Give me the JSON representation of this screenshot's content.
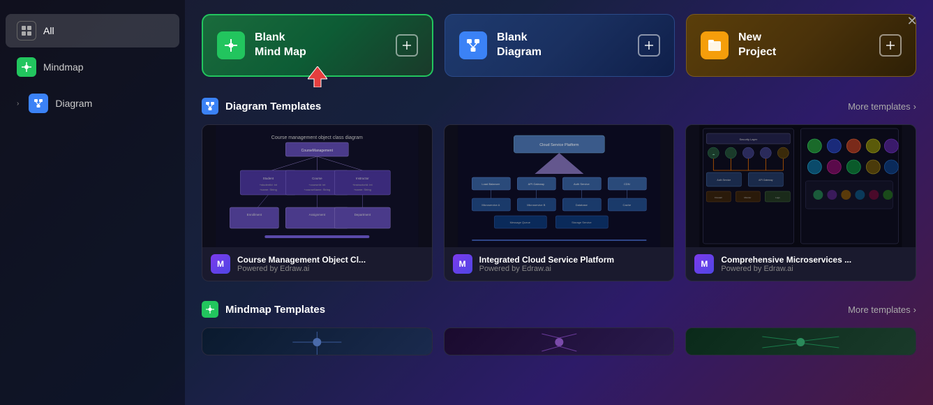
{
  "sidebar": {
    "items": [
      {
        "id": "all",
        "label": "All",
        "icon": "grid",
        "active": true
      },
      {
        "id": "mindmap",
        "label": "Mindmap",
        "icon": "mindmap"
      },
      {
        "id": "diagram",
        "label": "Diagram",
        "icon": "diagram",
        "hasChevron": true
      }
    ]
  },
  "topCards": [
    {
      "id": "blank-mindmap",
      "line1": "Blank",
      "line2": "Mind Map",
      "iconType": "mindmap",
      "addLabel": "+",
      "hasArrow": true
    },
    {
      "id": "blank-diagram",
      "line1": "Blank",
      "line2": "Diagram",
      "iconType": "diagram",
      "addLabel": "+"
    },
    {
      "id": "new-project",
      "line1": "New",
      "line2": "Project",
      "iconType": "project",
      "addLabel": "+"
    }
  ],
  "sections": [
    {
      "id": "diagram-templates",
      "title": "Diagram Templates",
      "iconType": "diagram",
      "moreLabel": "More templates",
      "templates": [
        {
          "name": "Course Management Object Cl...",
          "powered": "Powered by Edraw.ai"
        },
        {
          "name": "Integrated Cloud Service Platform",
          "powered": "Powered by Edraw.ai"
        },
        {
          "name": "Comprehensive Microservices ...",
          "powered": "Powered by Edraw.ai"
        }
      ]
    },
    {
      "id": "mindmap-templates",
      "title": "Mindmap Templates",
      "iconType": "mindmap",
      "moreLabel": "More templates"
    }
  ],
  "closeLabel": "✕",
  "icons": {
    "chevronRight": "›",
    "grid": "⊞"
  }
}
